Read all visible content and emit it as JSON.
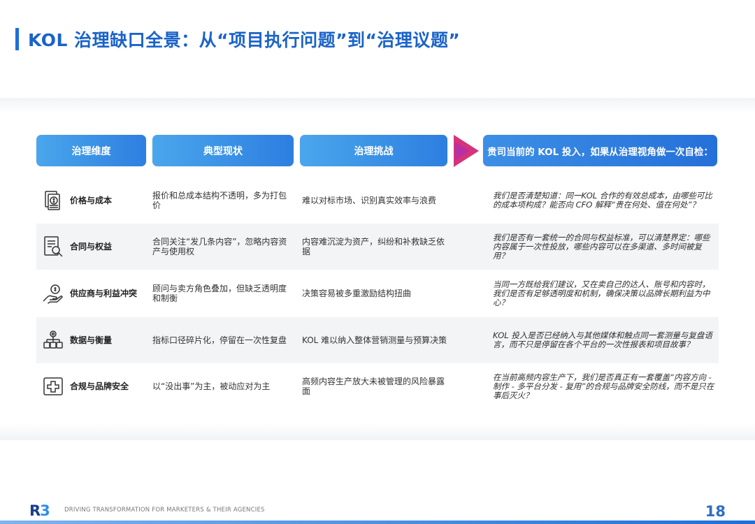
{
  "title": "KOL 治理缺口全景：从“项目执行问题”到“治理议题”",
  "headers": {
    "dimension": "治理维度",
    "status": "典型现状",
    "challenge": "治理挑战",
    "question": "贵司当前的 KOL 投入，如果从治理视角做一次自检："
  },
  "rows": [
    {
      "icon": "price-cost-icon",
      "dimension": "价格与成本",
      "status": "报价和总成本结构不透明，多为打包价",
      "challenge": "难以对标市场、识别真实效率与浪费",
      "question": "我们是否清楚知道：同一KOL 合作的有效总成本，由哪些可比的成本项构成？能否向 CFO 解释“贵在何处、值在何处”？"
    },
    {
      "icon": "contract-search-icon",
      "dimension": "合同与权益",
      "status": "合同关注“发几条内容”，忽略内容资产与使用权",
      "challenge": "内容难沉淀为资产，纠纷和补救缺乏依据",
      "question": "我们是否有一套统一的合同与权益标准，可以清楚界定：哪些内容属于一次性投放，哪些内容可以在多渠道、多时间被复用？"
    },
    {
      "icon": "hand-money-icon",
      "dimension": "供应商与利益冲突",
      "status": "顾问与卖方角色叠加，但缺乏透明度和制衡",
      "challenge": "决策容易被多重激励结构扭曲",
      "question": "当同一方既给我们建议，又在卖自己的达人、账号和内容时，我们是否有足够透明度和机制，确保决策以品牌长期利益为中心？"
    },
    {
      "icon": "data-network-icon",
      "dimension": "数据与衡量",
      "status": "指标口径碎片化，停留在一次性复盘",
      "challenge": "KOL 难以纳入整体营销测量与预算决策",
      "question": "KOL 投入是否已经纳入与其他媒体和触点同一套测量与复盘语言，而不只是停留在各个平台的一次性报表和项目故事？"
    },
    {
      "icon": "medical-cross-icon",
      "dimension": "合规与品牌安全",
      "status": "以“没出事”为主，被动应对为主",
      "challenge": "高频内容生产放大未被管理的风险暴露面",
      "question": "在当前高频内容生产下，我们是否真正有一套覆盖“内容方向 - 制作 - 多平台分发 - 复用”的合规与品牌安全防线，而不是只在事后灭火？"
    }
  ],
  "footer": {
    "logo_main": "R",
    "logo_accent": "3",
    "text": "DRIVING TRANSFORMATION FOR MARKETERS & THEIR AGENCIES",
    "page": "18"
  }
}
